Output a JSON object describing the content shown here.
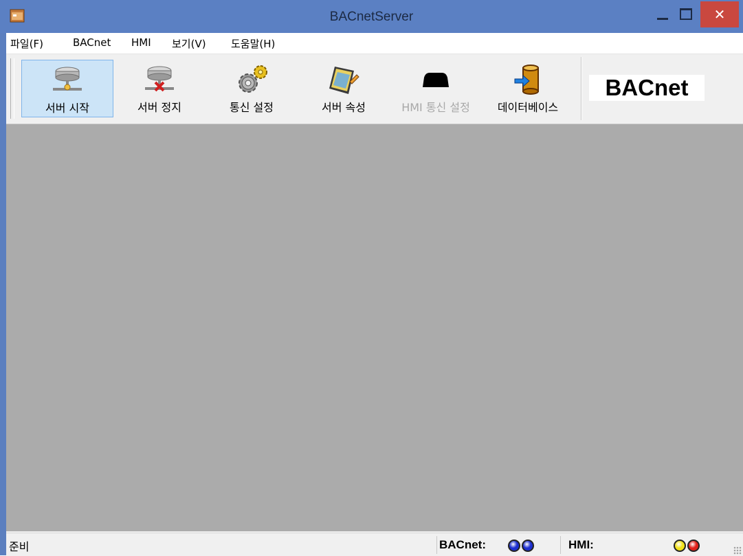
{
  "window": {
    "title": "BACnetServer",
    "close_glyph": "✕"
  },
  "menu": [
    {
      "label": "파일(F)"
    },
    {
      "label": "BACnet"
    },
    {
      "label": "HMI"
    },
    {
      "label": "보기(V)"
    },
    {
      "label": "도움말(H)"
    }
  ],
  "toolbar": {
    "buttons": [
      {
        "label": "서버 시작",
        "icon": "server-start-icon",
        "state": "pressed"
      },
      {
        "label": "서버 정지",
        "icon": "server-stop-icon",
        "state": "normal"
      },
      {
        "label": "통신 설정",
        "icon": "gears-icon",
        "state": "normal"
      },
      {
        "label": "서버 속성",
        "icon": "properties-icon",
        "state": "normal"
      },
      {
        "label": "HMI 통신 설정",
        "icon": "hmi-icon",
        "state": "disabled"
      },
      {
        "label": "데이터베이스",
        "icon": "database-icon",
        "state": "normal"
      }
    ],
    "logo_text": "BACnet"
  },
  "statusbar": {
    "status": "준비",
    "bacnet_label": "BACnet:",
    "hmi_label": "HMI:",
    "bacnet_leds": [
      "#1d2fd0",
      "#1d2fd0"
    ],
    "hmi_leds": [
      "#f2e21b",
      "#e0201a"
    ]
  }
}
